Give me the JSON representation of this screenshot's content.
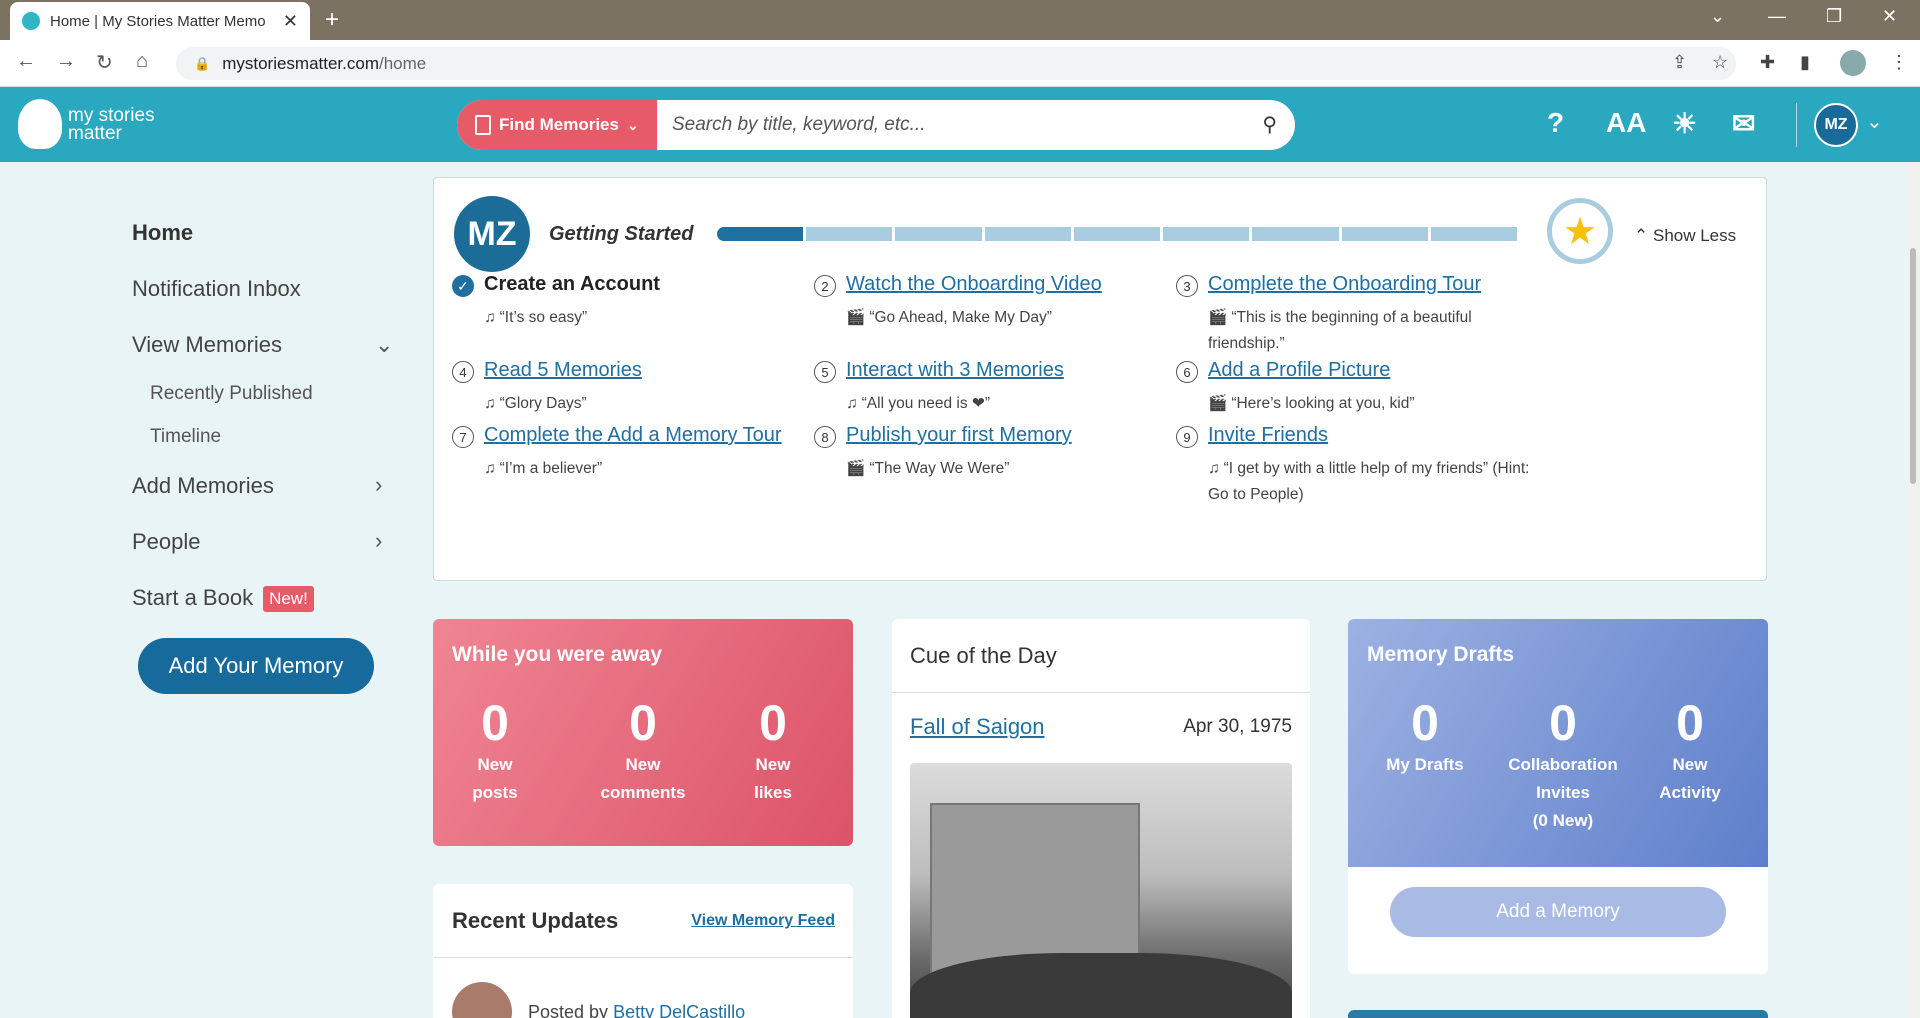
{
  "browser": {
    "tab_title": "Home | My Stories Matter Memo",
    "url_domain": "mystoriesmatter.com",
    "url_path": "/home"
  },
  "header": {
    "logo_line1": "my stories",
    "logo_line2": "matter",
    "find_label": "Find Memories",
    "search_placeholder": "Search by title, keyword, etc...",
    "avatar_initials": "MZ"
  },
  "sidebar": {
    "home": "Home",
    "inbox": "Notification Inbox",
    "view_memories": "View Memories",
    "recently_published": "Recently Published",
    "timeline": "Timeline",
    "add_memories": "Add Memories",
    "people": "People",
    "start_book": "Start a Book",
    "new_badge": "New!",
    "add_your_memory": "Add Your Memory"
  },
  "getting_started": {
    "avatar_initials": "MZ",
    "title": "Getting Started",
    "progress_completed": 1,
    "progress_total": 9,
    "show_less": "Show Less",
    "tasks": [
      {
        "num": "1",
        "title": "Create an Account",
        "cue": "“It’s so easy”",
        "cue_icon": "♫",
        "done": true
      },
      {
        "num": "2",
        "title": "Watch the Onboarding Video",
        "cue": "“Go Ahead, Make My Day”",
        "cue_icon": "🎬",
        "done": false
      },
      {
        "num": "3",
        "title": "Complete the Onboarding Tour",
        "cue": "“This is the beginning of a beautiful friendship.”",
        "cue_icon": "🎬",
        "done": false
      },
      {
        "num": "4",
        "title": "Read 5 Memories",
        "cue": "“Glory Days”",
        "cue_icon": "♫",
        "done": false
      },
      {
        "num": "5",
        "title": "Interact with 3 Memories",
        "cue": "“All you need is ❤”",
        "cue_icon": "♫",
        "done": false
      },
      {
        "num": "6",
        "title": "Add a Profile Picture",
        "cue": "“Here’s looking at you, kid”",
        "cue_icon": "🎬",
        "done": false
      },
      {
        "num": "7",
        "title": "Complete the Add a Memory Tour",
        "cue": "“I’m a believer”",
        "cue_icon": "♫",
        "done": false
      },
      {
        "num": "8",
        "title": "Publish your first Memory",
        "cue": "“The Way We Were”",
        "cue_icon": "🎬",
        "done": false
      },
      {
        "num": "9",
        "title": "Invite Friends",
        "cue": "“I get by with a little help of my friends” (Hint: Go to People)",
        "cue_icon": "♫",
        "done": false
      }
    ]
  },
  "away": {
    "title": "While you were away",
    "stats": [
      {
        "value": "0",
        "label1": "New",
        "label2": "posts"
      },
      {
        "value": "0",
        "label1": "New",
        "label2": "comments"
      },
      {
        "value": "0",
        "label1": "New",
        "label2": "likes"
      }
    ]
  },
  "cue_of_day": {
    "title": "Cue of the Day",
    "event": "Fall of Saigon",
    "date": "Apr 30, 1975"
  },
  "drafts": {
    "title": "Memory Drafts",
    "stats": [
      {
        "value": "0",
        "label": "My Drafts",
        "label2": "",
        "label3": ""
      },
      {
        "value": "0",
        "label": "Collaboration",
        "label2": "Invites",
        "label3": "(0 New)"
      },
      {
        "value": "0",
        "label": "New",
        "label2": "Activity",
        "label3": ""
      }
    ],
    "button": "Add a Memory"
  },
  "updates": {
    "title": "Recent Updates",
    "link": "View Memory Feed",
    "posted_by": "Posted by",
    "author": "Betty DelCastillo"
  },
  "colors": {
    "header": "#2aa8c0",
    "accent_red": "#e75b69",
    "primary_blue": "#176a9c",
    "drafts_blue": "#5e7fcb"
  }
}
